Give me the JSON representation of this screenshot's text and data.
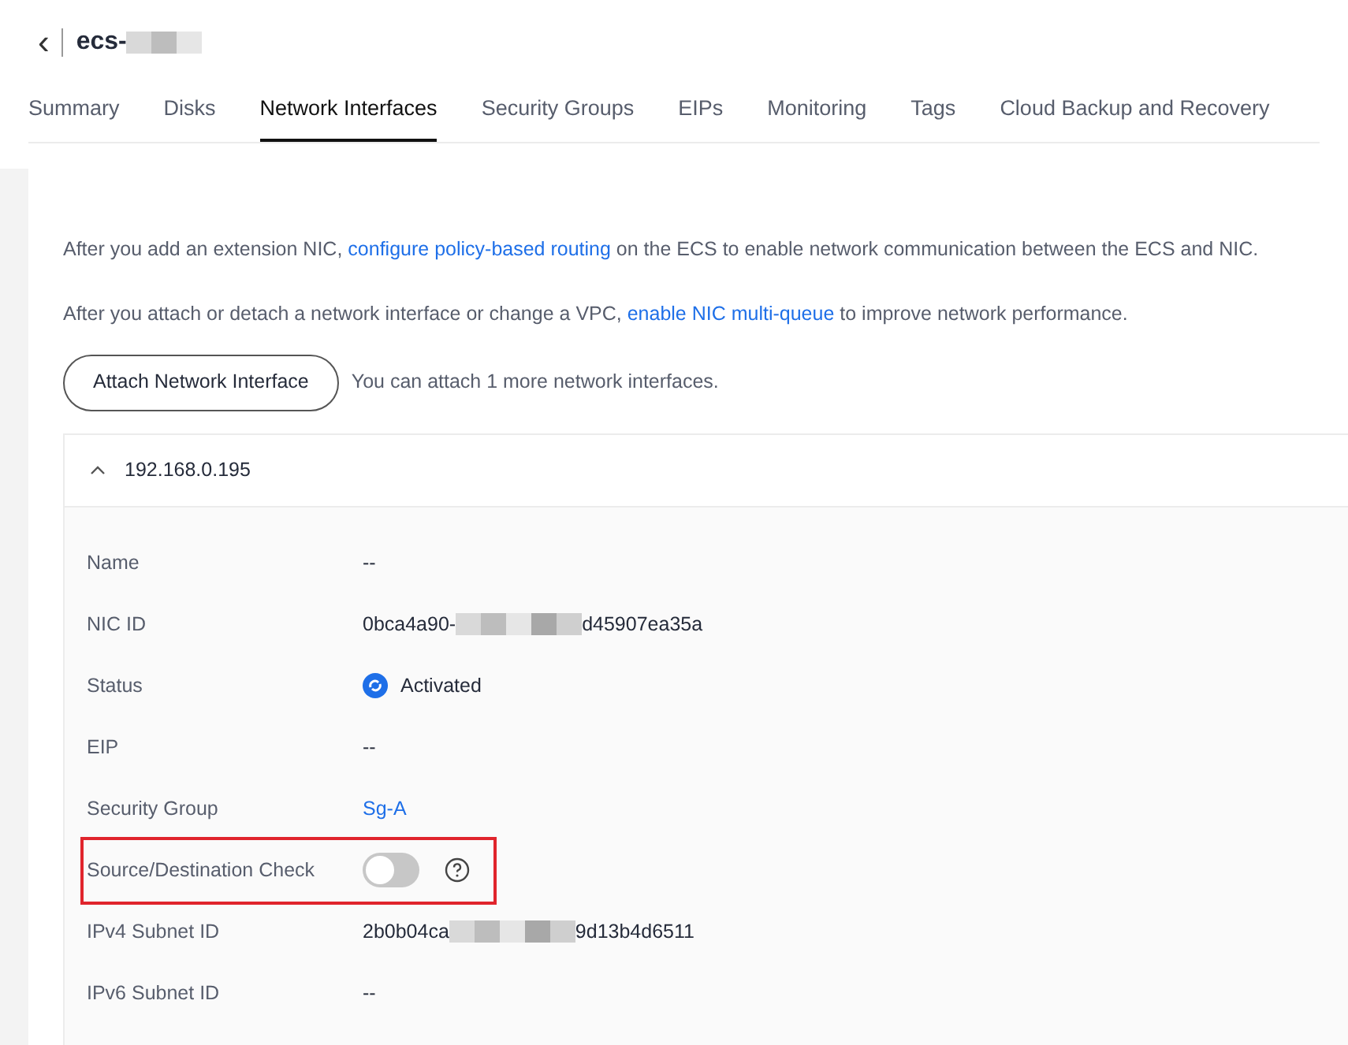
{
  "header": {
    "back_icon": "‹",
    "title_prefix": "ecs-"
  },
  "tabs": [
    {
      "label": "Summary",
      "selected": false
    },
    {
      "label": "Disks",
      "selected": false
    },
    {
      "label": "Network Interfaces",
      "selected": true
    },
    {
      "label": "Security Groups",
      "selected": false
    },
    {
      "label": "EIPs",
      "selected": false
    },
    {
      "label": "Monitoring",
      "selected": false
    },
    {
      "label": "Tags",
      "selected": false
    },
    {
      "label": "Cloud Backup and Recovery",
      "selected": false
    }
  ],
  "notices": [
    {
      "before": "After you add an extension NIC, ",
      "link": "configure policy-based routing",
      "after": " on the ECS to enable network communication between the ECS and NIC."
    },
    {
      "before": "After you attach or detach a network interface or change a VPC, ",
      "link": "enable NIC multi-queue",
      "after": " to improve network performance."
    }
  ],
  "attach_button": "Attach Network Interface",
  "attach_hint": "You can attach 1 more network interfaces.",
  "nic": {
    "address": "192.168.0.195",
    "expanded": true,
    "fields": [
      {
        "kind": "text",
        "label": "Name",
        "value": "--"
      },
      {
        "kind": "redacted",
        "label": "NIC ID",
        "value_start": "0bca4a90-",
        "value_end": "d45907ea35a"
      },
      {
        "kind": "status",
        "label": "Status",
        "value": "Activated"
      },
      {
        "kind": "text",
        "label": "EIP",
        "value": "--"
      },
      {
        "kind": "link",
        "label": "Security Group",
        "value": "Sg-A"
      },
      {
        "kind": "toggle",
        "label": "Source/Destination Check",
        "on": false,
        "highlighted": true
      },
      {
        "kind": "redacted",
        "label": "IPv4 Subnet ID",
        "value_start": "2b0b04ca",
        "value_end": "9d13b4d6511"
      },
      {
        "kind": "text",
        "label": "IPv6 Subnet ID",
        "value": "--"
      }
    ]
  }
}
